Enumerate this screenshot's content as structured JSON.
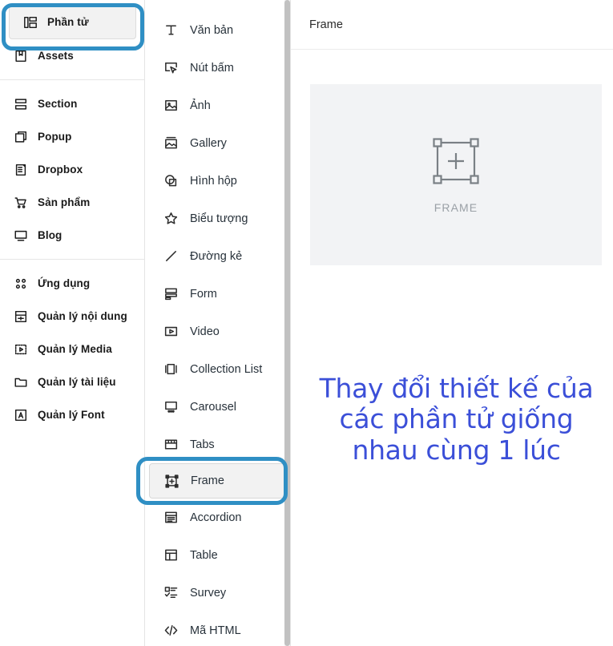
{
  "sidebar": {
    "groups": [
      {
        "items": [
          {
            "label": "Phần tử",
            "icon": "layout-grid-icon",
            "name": "sidebar-item-phan-tu",
            "selected": true
          },
          {
            "label": "Assets",
            "icon": "bookmark-icon",
            "name": "sidebar-item-assets",
            "selected": false
          }
        ]
      },
      {
        "items": [
          {
            "label": "Section",
            "icon": "section-icon",
            "name": "sidebar-item-section",
            "selected": false
          },
          {
            "label": "Popup",
            "icon": "popup-icon",
            "name": "sidebar-item-popup",
            "selected": false
          },
          {
            "label": "Dropbox",
            "icon": "dropbox-icon",
            "name": "sidebar-item-dropbox",
            "selected": false
          },
          {
            "label": "Sản phẩm",
            "icon": "cart-icon",
            "name": "sidebar-item-san-pham",
            "selected": false
          },
          {
            "label": "Blog",
            "icon": "monitor-icon",
            "name": "sidebar-item-blog",
            "selected": false
          }
        ]
      },
      {
        "items": [
          {
            "label": "Ứng dụng",
            "icon": "apps-grid-icon",
            "name": "sidebar-item-ung-dung",
            "selected": false
          },
          {
            "label": "Quản lý nội dung",
            "icon": "content-manager-icon",
            "name": "sidebar-item-quan-ly-noi-dung",
            "selected": false
          },
          {
            "label": "Quản lý Media",
            "icon": "media-manager-icon",
            "name": "sidebar-item-quan-ly-media",
            "selected": false
          },
          {
            "label": "Quản lý tài liệu",
            "icon": "folder-icon",
            "name": "sidebar-item-quan-ly-tai-lieu",
            "selected": false
          },
          {
            "label": "Quản lý Font",
            "icon": "font-icon",
            "name": "sidebar-item-quan-ly-font",
            "selected": false
          }
        ]
      }
    ]
  },
  "elements": {
    "items": [
      {
        "label": "Văn bản",
        "icon": "text-icon",
        "name": "element-item-van-ban",
        "selected": false
      },
      {
        "label": "Nút bấm",
        "icon": "button-cursor-icon",
        "name": "element-item-nut-bam",
        "selected": false
      },
      {
        "label": "Ảnh",
        "icon": "image-icon",
        "name": "element-item-anh",
        "selected": false
      },
      {
        "label": "Gallery",
        "icon": "gallery-icon",
        "name": "element-item-gallery",
        "selected": false
      },
      {
        "label": "Hình hộp",
        "icon": "shape-box-icon",
        "name": "element-item-hinh-hop",
        "selected": false
      },
      {
        "label": "Biểu tượng",
        "icon": "star-icon",
        "name": "element-item-bieu-tuong",
        "selected": false
      },
      {
        "label": "Đường kẻ",
        "icon": "line-icon",
        "name": "element-item-duong-ke",
        "selected": false
      },
      {
        "label": "Form",
        "icon": "form-icon",
        "name": "element-item-form",
        "selected": false
      },
      {
        "label": "Video",
        "icon": "video-play-icon",
        "name": "element-item-video",
        "selected": false
      },
      {
        "label": "Collection List",
        "icon": "collection-list-icon",
        "name": "element-item-collection-list",
        "selected": false
      },
      {
        "label": "Carousel",
        "icon": "carousel-icon",
        "name": "element-item-carousel",
        "selected": false
      },
      {
        "label": "Tabs",
        "icon": "tabs-icon",
        "name": "element-item-tabs",
        "selected": false
      },
      {
        "label": "Frame",
        "icon": "frame-icon",
        "name": "element-item-frame",
        "selected": true
      },
      {
        "label": "Accordion",
        "icon": "accordion-icon",
        "name": "element-item-accordion",
        "selected": false
      },
      {
        "label": "Table",
        "icon": "table-icon",
        "name": "element-item-table",
        "selected": false
      },
      {
        "label": "Survey",
        "icon": "survey-icon",
        "name": "element-item-survey",
        "selected": false
      },
      {
        "label": "Mã HTML",
        "icon": "code-icon",
        "name": "element-item-ma-html",
        "selected": false
      }
    ]
  },
  "panel": {
    "title": "Frame",
    "preview": {
      "label": "FRAME",
      "icon": "frame-placeholder-icon",
      "background": "#f2f3f5"
    }
  },
  "annotation": {
    "text": "Thay đổi thiết kế của\ncác phần tử giống\nnhau cùng 1 lúc",
    "color": "#3b4fd8"
  },
  "highlights": {
    "color": "#2f8fc4",
    "targets": [
      "sidebar-item-phan-tu",
      "element-item-frame"
    ]
  }
}
